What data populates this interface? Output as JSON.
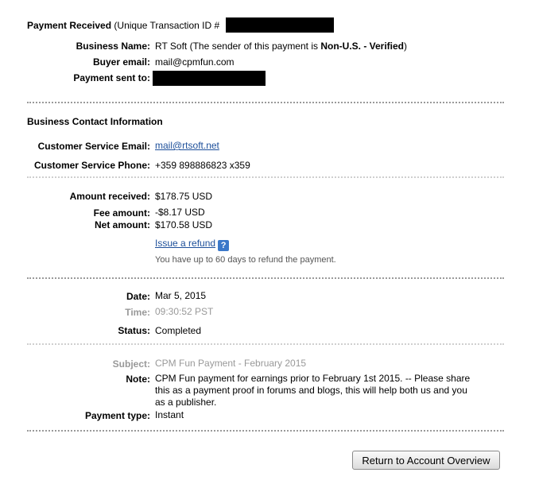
{
  "header": {
    "title": "Payment Received",
    "transaction_prefix": "(Unique Transaction ID #"
  },
  "sender": {
    "business_name_label": "Business Name:",
    "business_name_value": "RT Soft",
    "sender_note_prefix": " (The sender of this payment is ",
    "sender_status": "Non-U.S. - Verified",
    "sender_note_suffix": ")",
    "buyer_email_label": "Buyer email:",
    "buyer_email_value": "mail@cpmfun.com",
    "payment_sent_to_label": "Payment sent to:"
  },
  "contact": {
    "heading": "Business Contact Information",
    "email_label": "Customer Service Email:",
    "email_value": "mail@rtsoft.net",
    "phone_label": "Customer Service Phone:",
    "phone_value": "+359 898886823 x359"
  },
  "amounts": {
    "received_label": "Amount received:",
    "received_value": "$178.75 USD",
    "fee_label": "Fee amount:",
    "fee_value": "-$8.17 USD",
    "net_label": "Net amount:",
    "net_value": "$170.58 USD",
    "refund_link": "Issue a refund",
    "help_glyph": "?",
    "refund_note": "You have up to 60 days to refund the payment."
  },
  "details": {
    "date_label": "Date:",
    "date_value": "Mar 5, 2015",
    "time_label": "Time:",
    "time_value": "09:30:52 PST",
    "status_label": "Status:",
    "status_value": "Completed"
  },
  "message": {
    "subject_label": "Subject:",
    "subject_value": "CPM Fun Payment - February 2015",
    "note_label": "Note:",
    "note_line1": "CPM Fun payment for earnings prior to February 1st 2015. -- Please share",
    "note_line2": "this as a payment proof in forums and blogs, this will help both us and you",
    "note_line3": "as a publisher.",
    "payment_type_label": "Payment type:",
    "payment_type_value": "Instant"
  },
  "actions": {
    "return_button": "Return to Account Overview"
  },
  "colors": {
    "link": "#1d4f9a",
    "muted_label": "#999999",
    "help_icon": "#3b78c9"
  },
  "icons": {
    "help": "help-icon"
  }
}
